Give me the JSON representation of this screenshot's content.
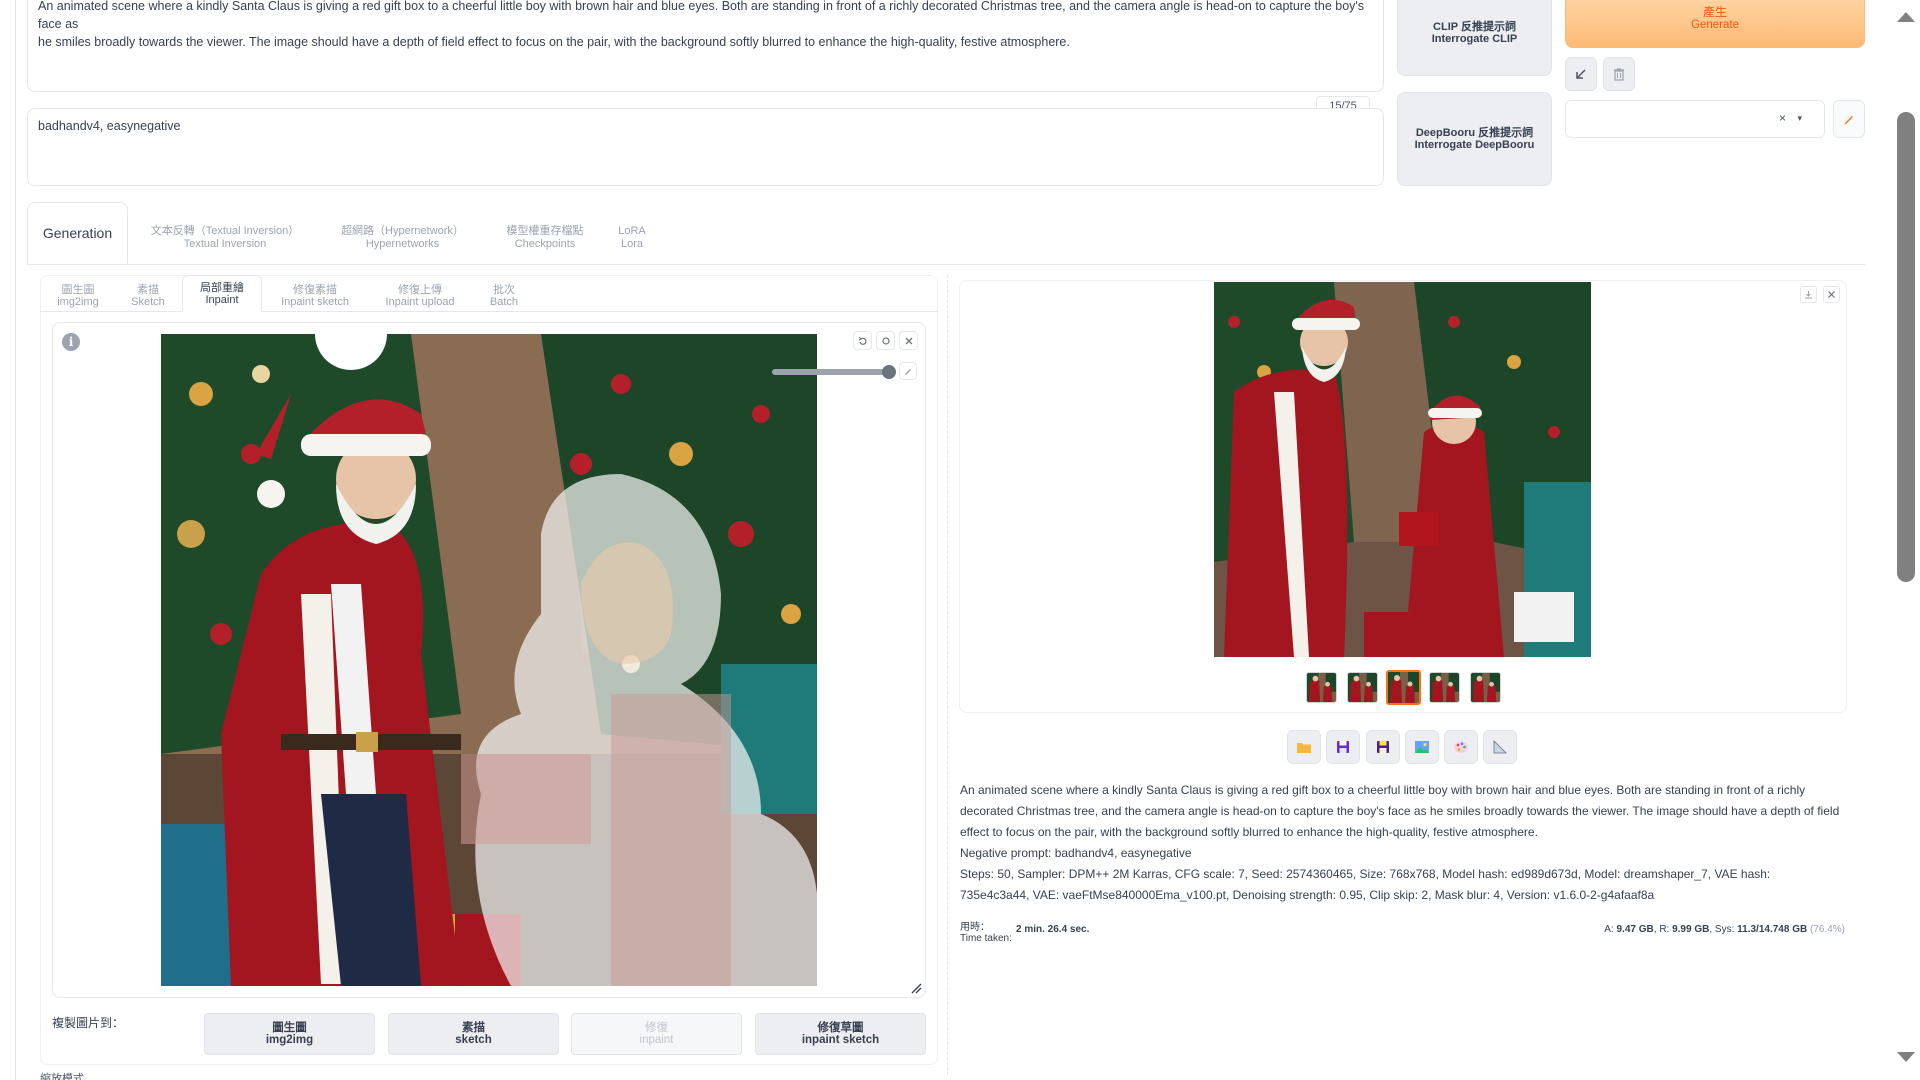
{
  "prompt": {
    "line1": "An animated scene where a kindly Santa Claus is giving a red gift box to a cheerful little boy with brown hair and blue eyes. Both are standing in front of a richly decorated Christmas tree, and the camera angle is head-on to capture the boy's face as",
    "line2": "he smiles broadly towards the viewer. The image should have a depth of field effect to focus on the pair, with the background softly blurred to enhance the high-quality, festive atmosphere."
  },
  "negative_prompt": {
    "value": "badhandv4, easynegative",
    "token_count": "15/75"
  },
  "interrogate": {
    "clip_zh": "CLIP 反推提示詞",
    "clip_en": "Interrogate CLIP",
    "deepbooru_zh": "DeepBooru 反推提示詞",
    "deepbooru_en": "Interrogate DeepBooru"
  },
  "generate": {
    "zh": "產生",
    "en": "Generate"
  },
  "styles": {
    "clear": "×",
    "caret": "▾"
  },
  "top_tabs": [
    {
      "zh": "Generation",
      "en": ""
    },
    {
      "zh": "文本反轉（Textual Inversion）",
      "en": "Textual Inversion"
    },
    {
      "zh": "超網路（Hypernetwork）",
      "en": "Hypernetworks"
    },
    {
      "zh": "模型權重存檔點",
      "en": "Checkpoints"
    },
    {
      "zh": "LoRA",
      "en": "Lora"
    }
  ],
  "sub_tabs": [
    {
      "zh": "圖生圖",
      "en": "img2img"
    },
    {
      "zh": "素描",
      "en": "Sketch"
    },
    {
      "zh": "局部重繪",
      "en": "Inpaint"
    },
    {
      "zh": "修復素描",
      "en": "Inpaint sketch"
    },
    {
      "zh": "修復上傳",
      "en": "Inpaint upload"
    },
    {
      "zh": "批次",
      "en": "Batch"
    }
  ],
  "canvas": {
    "info": "i"
  },
  "copy_to": {
    "label": "複製圖片到：",
    "buttons": [
      {
        "zh": "圖生圖",
        "en": "img2img",
        "enabled": true
      },
      {
        "zh": "素描",
        "en": "sketch",
        "enabled": true
      },
      {
        "zh": "修復",
        "en": "inpaint",
        "enabled": false
      },
      {
        "zh": "修復草圖",
        "en": "inpaint sketch",
        "enabled": true
      }
    ]
  },
  "scale_mode_label": "縮放模式",
  "gallery": {
    "thumb_count": 5,
    "selected_index": 2
  },
  "info_text": {
    "prompt_line": "An animated scene where a kindly Santa Claus is giving a red gift box to a cheerful little boy with brown hair and blue eyes. Both are standing in front of a richly decorated Christmas tree, and the camera angle is head-on to capture the boy's face as he smiles broadly towards the viewer. The image should have a depth of field effect to focus on the pair, with the background softly blurred to enhance the high-quality, festive atmosphere.",
    "negative": "Negative prompt: badhandv4, easynegative",
    "params": "Steps: 50, Sampler: DPM++ 2M Karras, CFG scale: 7, Seed: 2574360465, Size: 768x768, Model hash: ed989d673d, Model: dreamshaper_7, VAE hash: 735e4c3a44, VAE: vaeFtMse840000Ema_v100.pt, Denoising strength: 0.95, Clip skip: 2, Mask blur: 4, Version: v1.6.0-2-g4afaaf8a"
  },
  "timing": {
    "label_zh": "用時：",
    "label_en": "Time taken:",
    "value": "2 min. 26.4 sec.",
    "a_label": "A:",
    "a_val": "9.47 GB",
    "r_label": "R:",
    "r_val": "9.99 GB",
    "sys_label": "Sys:",
    "sys_val": "11.3/14.748 GB",
    "sys_pct": "(76.4%)"
  },
  "colors": {
    "accent": "#f97316",
    "generate_text": "#ea580c"
  }
}
